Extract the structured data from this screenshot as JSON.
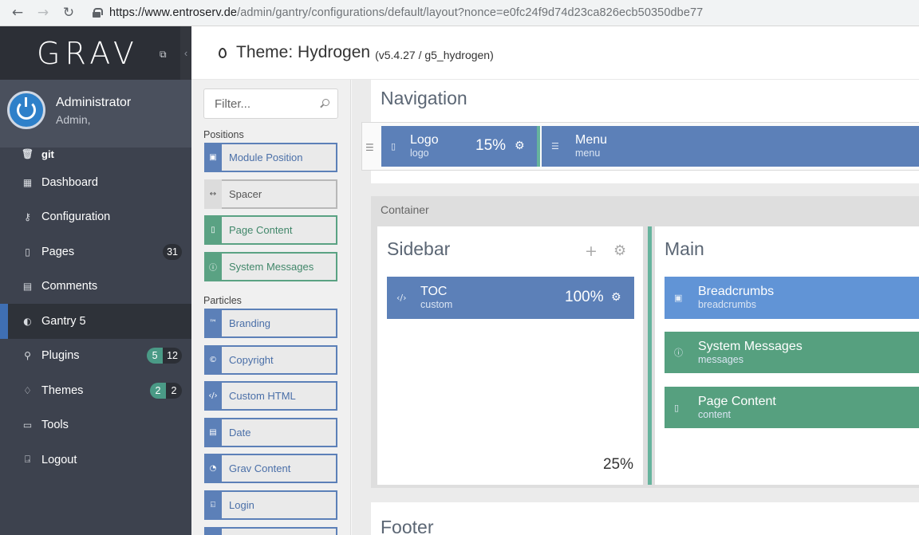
{
  "browser": {
    "url_host": "https://www.entroserv.de",
    "url_path": "/admin/gantry/configurations/default/layout?nonce=e0fc24f9d74d23ca826ecb50350dbe77"
  },
  "sidebar": {
    "logo": "GRAV",
    "user": {
      "name": "Administrator",
      "role": "Admin,"
    },
    "items": [
      {
        "label": "git",
        "icon": "trash-icon"
      },
      {
        "label": "Dashboard",
        "icon": "grid-icon"
      },
      {
        "label": "Configuration",
        "icon": "wrench-icon"
      },
      {
        "label": "Pages",
        "icon": "file-icon",
        "badge": "31"
      },
      {
        "label": "Comments",
        "icon": "calendar-icon"
      },
      {
        "label": "Gantry 5",
        "icon": "gantry-icon",
        "active": true
      },
      {
        "label": "Plugins",
        "icon": "plug-icon",
        "badge_green": "5",
        "badge_dark": "12"
      },
      {
        "label": "Themes",
        "icon": "drop-icon",
        "badge_green": "2",
        "badge_dark": "2"
      },
      {
        "label": "Tools",
        "icon": "briefcase-icon"
      },
      {
        "label": "Logout",
        "icon": "logout-icon"
      }
    ]
  },
  "header": {
    "title": "Theme: Hydrogen",
    "version": "(v5.4.27 / g5_hydrogen)"
  },
  "particles_panel": {
    "filter_placeholder": "Filter...",
    "positions_label": "Positions",
    "particles_label": "Particles",
    "positions": [
      {
        "label": "Module Position",
        "icon": "module-icon"
      },
      {
        "label": "Spacer",
        "icon": "arrows-icon"
      },
      {
        "label": "Page Content",
        "icon": "file-icon"
      },
      {
        "label": "System Messages",
        "icon": "info-icon"
      }
    ],
    "particles": [
      {
        "label": "Branding",
        "icon": "tm-icon"
      },
      {
        "label": "Copyright",
        "icon": "copyright-icon"
      },
      {
        "label": "Custom HTML",
        "icon": "code-icon"
      },
      {
        "label": "Date",
        "icon": "calendar-icon"
      },
      {
        "label": "Grav Content",
        "icon": "grav-icon"
      },
      {
        "label": "Login",
        "icon": "login-icon"
      }
    ]
  },
  "layout": {
    "navigation": {
      "title": "Navigation",
      "logo": {
        "name": "Logo",
        "type": "logo",
        "percent": "15%"
      },
      "menu": {
        "name": "Menu",
        "type": "menu"
      }
    },
    "container": {
      "label": "Container",
      "sidebar": {
        "title": "Sidebar",
        "percent": "25%",
        "toc": {
          "name": "TOC",
          "type": "custom",
          "percent": "100%"
        }
      },
      "main": {
        "title": "Main",
        "breadcrumbs": {
          "name": "Breadcrumbs",
          "type": "breadcrumbs"
        },
        "messages": {
          "name": "System Messages",
          "type": "messages"
        },
        "content": {
          "name": "Page Content",
          "type": "content"
        }
      }
    },
    "footer": {
      "title": "Footer"
    }
  }
}
